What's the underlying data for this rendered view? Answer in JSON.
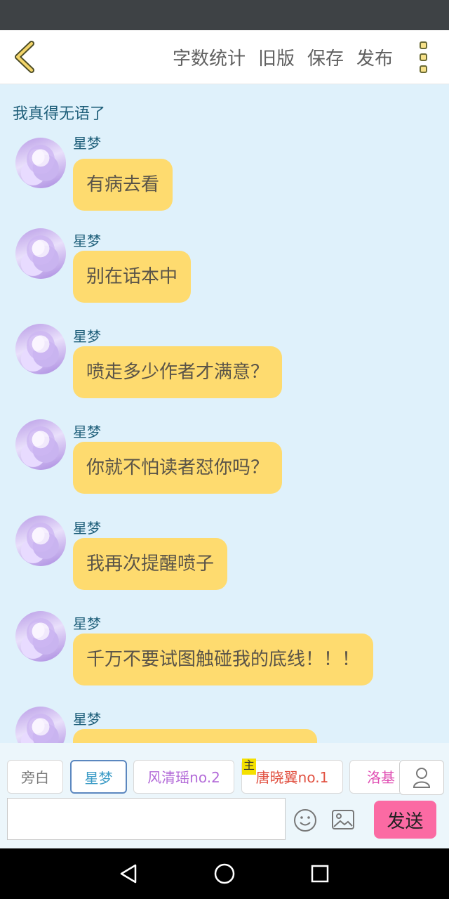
{
  "toolbar": {
    "actions": [
      "字数统计",
      "旧版",
      "保存",
      "发布"
    ]
  },
  "chat": {
    "title": "我真得无语了",
    "messages": [
      {
        "sender": "星梦",
        "text": "有病去看"
      },
      {
        "sender": "星梦",
        "text": "别在话本中"
      },
      {
        "sender": "星梦",
        "text": "喷走多少作者才满意？"
      },
      {
        "sender": "星梦",
        "text": "你就不怕读者怼你吗？"
      },
      {
        "sender": "星梦",
        "text": "我再次提醒喷子"
      },
      {
        "sender": "星梦",
        "text": "千万不要试图触碰我的底线！！！"
      },
      {
        "sender": "星梦",
        "text": ""
      }
    ]
  },
  "roles": {
    "tabs": [
      {
        "label": "旁白",
        "color": "#7b7b7b"
      },
      {
        "label": "星梦",
        "color": "#3b9bc6"
      },
      {
        "label": "风清瑶no.2",
        "color": "#b36bd8"
      },
      {
        "label": "唐晓翼no.1",
        "color": "#e15141"
      },
      {
        "label": "洛基",
        "color": "#e04fb3"
      }
    ],
    "host_tag": "主"
  },
  "composer": {
    "input_value": "",
    "input_placeholder": "",
    "send_label": "发送"
  },
  "colors": {
    "status_bar": "#3e4245",
    "chat_bg": "#dff1fb",
    "bubble": "#fedb6f",
    "send_button": "#fb6aa3"
  }
}
